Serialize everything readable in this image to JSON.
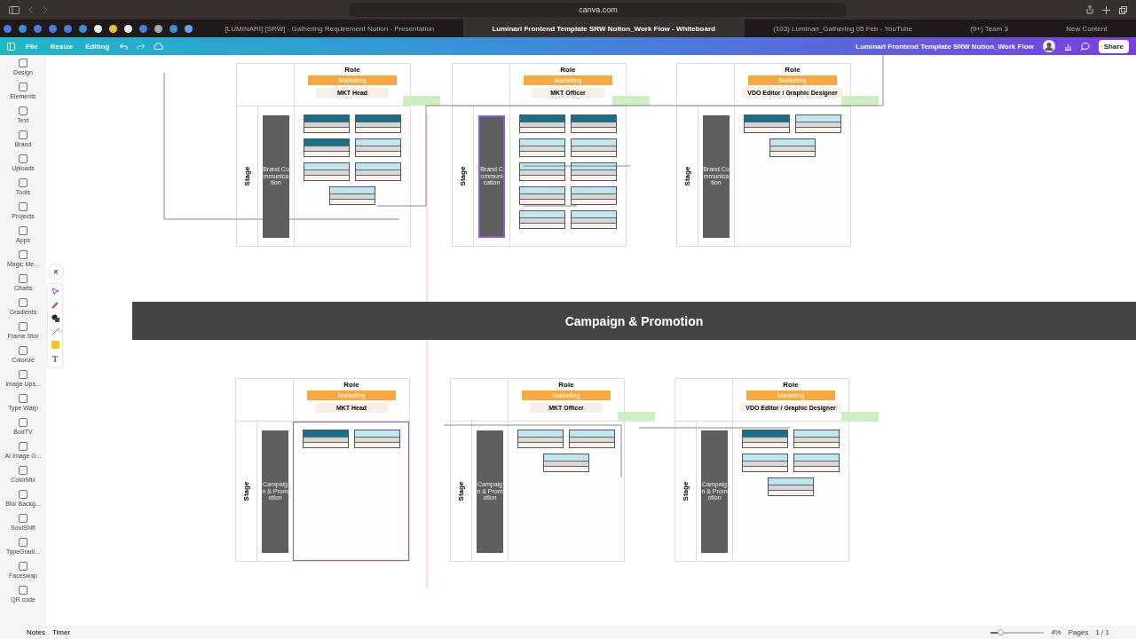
{
  "browser": {
    "address": "canva.com",
    "tabs": [
      {
        "title": "[LUMINARI] [SRW] - Gathering Requirement Notion - Presentation",
        "selected": false
      },
      {
        "title": "Luminari Frontend Template SRW Notion_Work Flow - Whiteboard",
        "selected": true
      },
      {
        "title": "(103) Luminari_Gathering 05 Feb - YouTube",
        "selected": false
      },
      {
        "title": "(9+) Team 3",
        "selected": false
      },
      {
        "title": "New Content",
        "selected": false
      }
    ]
  },
  "toolbar": {
    "menu": [
      "File",
      "Resize",
      "Editing"
    ],
    "title": "Luminari Frontend Template SRW Notion_Work Flow",
    "share": "Share"
  },
  "sidebar": {
    "items": [
      "Design",
      "Elements",
      "Text",
      "Brand",
      "Uploads",
      "Tools",
      "Projects",
      "Apps",
      "Magic Me...",
      "Charts",
      "Gradients",
      "Frame Stor",
      "Colorize",
      "Image Ups...",
      "Type Warp",
      "BodTV",
      "AI Image G...",
      "ColorMix",
      "Blur Backg...",
      "SoulShift",
      "TypeGradi...",
      "Faceswap",
      "QR code"
    ]
  },
  "palette": {
    "close": "×",
    "text_tool": "T"
  },
  "top_frames": [
    {
      "header": "Role",
      "department": "Marketing",
      "role": "MKT Head",
      "lane": "Stage",
      "stage": "Brand Communication",
      "bar_selected": false,
      "content_selected": false,
      "boxes": [
        {
          "kind": "dark"
        },
        {
          "kind": "dark"
        },
        {
          "kind": "dark"
        },
        {
          "kind": "light"
        },
        {
          "kind": "light"
        },
        {
          "kind": "light"
        },
        {
          "kind": "light"
        }
      ]
    },
    {
      "header": "Role",
      "department": "Marketing",
      "role": "MKT Officer",
      "lane": "Stage",
      "stage": "Brand Communication",
      "bar_selected": true,
      "content_selected": false,
      "boxes": [
        {
          "kind": "dark"
        },
        {
          "kind": "dark"
        },
        {
          "kind": "light"
        },
        {
          "kind": "light"
        },
        {
          "kind": "light"
        },
        {
          "kind": "light"
        },
        {
          "kind": "light"
        },
        {
          "kind": "light"
        },
        {
          "kind": "light"
        },
        {
          "kind": "light"
        }
      ]
    },
    {
      "header": "Role",
      "department": "Marketing",
      "role": "VDO Editor / Graphic Designer",
      "lane": "Stage",
      "stage": "Brand Communication",
      "bar_selected": false,
      "content_selected": false,
      "boxes": [
        {
          "kind": "dark"
        },
        {
          "kind": "light"
        },
        {
          "kind": "light"
        }
      ]
    }
  ],
  "banner": "Campaign & Promotion",
  "bottom_frames": [
    {
      "header": "Role",
      "department": "Marketing",
      "role": "MKT Head",
      "lane": "Stage",
      "stage": "Campaign & Promotion",
      "bar_selected": false,
      "content_selected": true,
      "boxes": [
        {
          "kind": "dark"
        },
        {
          "kind": "light"
        }
      ]
    },
    {
      "header": "Role",
      "department": "Marketing",
      "role": "MKT Officer",
      "lane": "Stage",
      "stage": "Campaign & Promotion",
      "bar_selected": false,
      "content_selected": false,
      "boxes": [
        {
          "kind": "light"
        },
        {
          "kind": "light"
        },
        {
          "kind": "light"
        }
      ]
    },
    {
      "header": "Role",
      "department": "Marketing",
      "role": "VDO Editor / Graphic Designer",
      "lane": "Stage",
      "stage": "Campaign & Promotion",
      "bar_selected": false,
      "content_selected": false,
      "boxes": [
        {
          "kind": "dark"
        },
        {
          "kind": "light"
        },
        {
          "kind": "light"
        },
        {
          "kind": "light"
        },
        {
          "kind": "light"
        }
      ]
    }
  ],
  "footer": {
    "notes": "Notes",
    "timer": "Timer",
    "zoom_slider": {
      "level": 0.2
    },
    "zoom": "4%",
    "pages_label": "Pages",
    "pages": "1 / 1"
  }
}
